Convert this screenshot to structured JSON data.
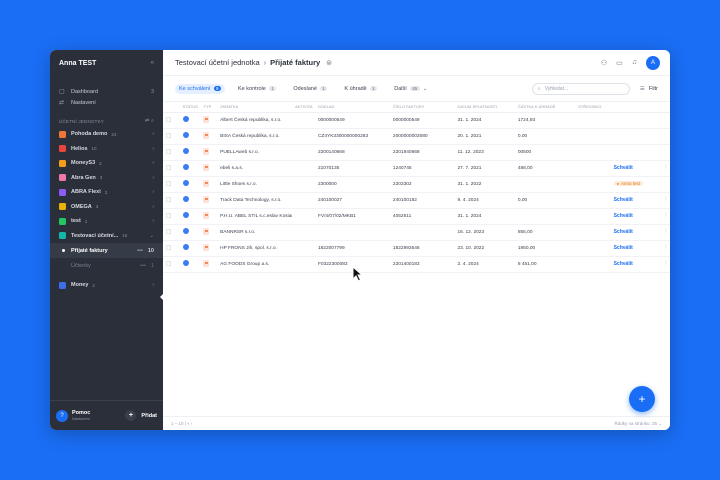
{
  "sidebar": {
    "user": "Anna TEST",
    "collapse": "«",
    "nav": [
      {
        "icon": "▢",
        "label": "Dashboard",
        "count": "3"
      },
      {
        "icon": "⇄",
        "label": "Nastavení",
        "count": ""
      }
    ],
    "section": {
      "label": "ÚČETNÍ JEDNOTKY",
      "tools": "⇄  ⌕"
    },
    "entities": [
      {
        "name": "Pohoda demo",
        "count": "24",
        "color": "#f0733a"
      },
      {
        "name": "Helios",
        "count": "10",
        "color": "#e8453c"
      },
      {
        "name": "MoneyS3",
        "count": "2",
        "color": "#f59e1b"
      },
      {
        "name": "Abra Gen",
        "count": "3",
        "color": "#f07aa6"
      },
      {
        "name": "ABRA Flexi",
        "count": "3",
        "color": "#8b5cf6"
      },
      {
        "name": "OMEGA",
        "count": "3",
        "color": "#eab308"
      },
      {
        "name": "test",
        "count": "1",
        "color": "#22c55e"
      },
      {
        "name": "Testovací účetní...",
        "count": "10",
        "color": "#14b8a6"
      }
    ],
    "subitems": [
      {
        "label": "Přijaté faktury",
        "count": "10"
      },
      {
        "label": "Účtenky",
        "count": "1"
      }
    ],
    "last_entity": {
      "name": "Money",
      "count": "2",
      "color": "#3b6fe8"
    },
    "help_title": "Pomoc",
    "help_sub": "Nastavení",
    "add_label": "Přidat"
  },
  "topbar": {
    "crumb_parent": "Testovací účetní jednotka",
    "crumb_sep": "›",
    "crumb_current": "Přijaté faktury",
    "avatar": "A"
  },
  "tabs": [
    {
      "label": "Ke schválení",
      "badge": "9",
      "active": true
    },
    {
      "label": "Ke kontrole",
      "badge": "1"
    },
    {
      "label": "Odeslané",
      "badge": "1"
    },
    {
      "label": "K úhradě",
      "badge": "1"
    },
    {
      "label": "Další",
      "badge": "45",
      "chev": "⌄"
    }
  ],
  "search": {
    "placeholder": "Vyhledat..."
  },
  "filter_label": "Filtr",
  "table": {
    "headers": [
      "",
      "STATUS",
      "TYP",
      "ZKRATKA",
      "AKTIVITA",
      "DOKLAD",
      "ČÍSLO FAKTURY",
      "DATUM SPLATNOSTI",
      "ČÁSTKA K ÚHRADĚ",
      "STŘEDISKO",
      "",
      ""
    ],
    "rows": [
      [
        "",
        "",
        "",
        "Albert Česká republika, s.r.o.",
        "",
        "0000000549",
        "0000000549",
        "31. 1. 2024",
        "1724,93",
        "",
        "",
        ""
      ],
      [
        "",
        "",
        "",
        "BISA Česká republika, s.r.o.",
        "",
        "CZ4YK3300000000283",
        "2000000003080",
        "20. 1. 2021",
        "0.00",
        "",
        "",
        ""
      ],
      [
        "",
        "",
        "",
        "PUELLAweb s.r.o.",
        "",
        "2200140668",
        "2201940668",
        "11. 12. 2023",
        "00500",
        "",
        "",
        ""
      ],
      [
        "",
        "",
        "",
        "ebeli s.a.s.",
        "",
        "21070135",
        "1240745",
        "27. 7. 2021",
        "488,00",
        "",
        "Schválit",
        "⋮"
      ],
      [
        "",
        "",
        "",
        "Little Shoes s.r.o.",
        "",
        "2300000",
        "2203302",
        "31. 1. 2022",
        "",
        "",
        "Anna test",
        ""
      ],
      [
        "",
        "",
        "",
        "Track Data Technology, s.r.o.",
        "",
        "240100027",
        "240100182",
        "9. 4. 2024",
        "0,00",
        "",
        "Schválit",
        "⋮"
      ],
      [
        "",
        "",
        "",
        "P.H.U. ABEL STIL s.c.eslav Kosiarskey",
        "",
        "FV/4/07/02/MKB1",
        "4052611",
        "31. 1. 2024",
        "",
        "",
        "Schválit",
        "⋮"
      ],
      [
        "",
        "",
        "",
        "BANNRSR s.r.o.",
        "",
        "",
        "",
        "16. 12. 2023",
        "855,00",
        "",
        "Schválit",
        "⋮"
      ],
      [
        "",
        "",
        "",
        "HP FRONS Jih, spol. s.r.o.",
        "",
        "1822007799",
        "1822993546",
        "23. 10. 2022",
        "1950,00",
        "",
        "Schválit",
        "⋮"
      ],
      [
        "",
        "",
        "",
        "AG FOODS Group a.s.",
        "",
        "F0322300083",
        "2201400183",
        "2. 4. 2024",
        "8 451,00",
        "",
        "Schválit",
        "⋮"
      ]
    ]
  },
  "footer": {
    "left": "1 – 10 | « ‹",
    "right": "Řádky na stránku: 25 ⌄"
  },
  "fab": "+"
}
